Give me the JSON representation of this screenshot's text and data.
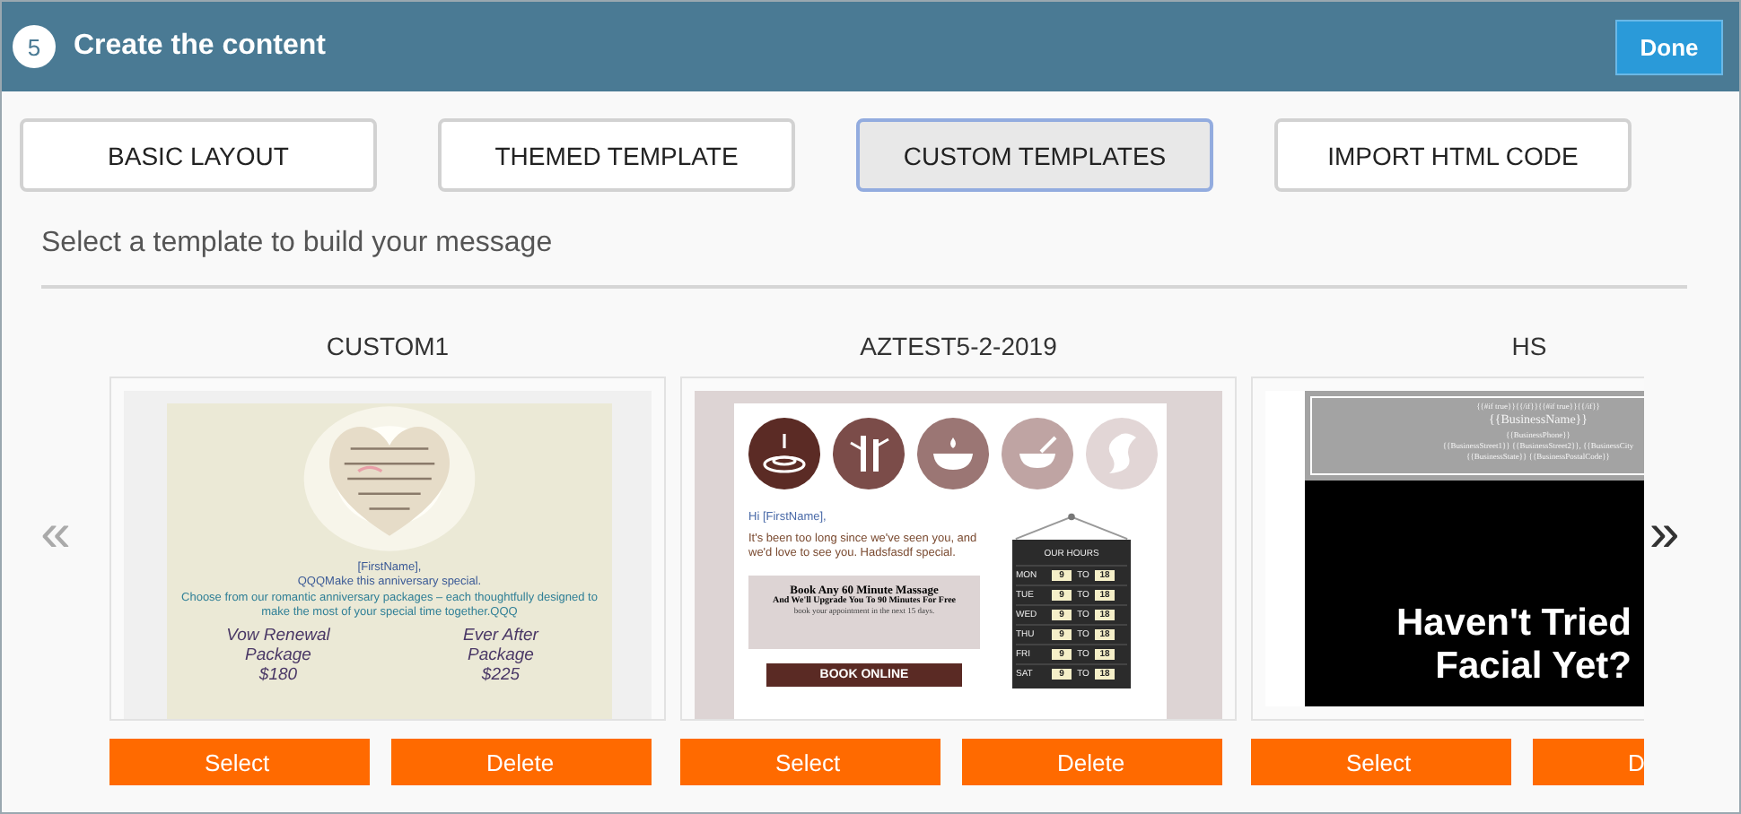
{
  "step": {
    "number": "5",
    "title": "Create the content",
    "done": "Done"
  },
  "tabs": [
    {
      "label": "BASIC LAYOUT",
      "selected": false
    },
    {
      "label": "THEMED TEMPLATE",
      "selected": false
    },
    {
      "label": "CUSTOM TEMPLATES",
      "selected": true
    },
    {
      "label": "IMPORT HTML CODE",
      "selected": false
    }
  ],
  "instruction": "Select a template to build your message",
  "carousel": {
    "prev": "«",
    "next": "»",
    "templates": [
      {
        "name": "CUSTOM1",
        "kind": "anniversary",
        "select": "Select",
        "delete": "Delete",
        "preview": {
          "greeting": "[FirstName],",
          "lines": [
            "QQQMake this anniversary special.",
            "Choose from our romantic anniversary packages – each thoughtfully designed to make the most of your special time together.QQQ"
          ],
          "packages": [
            {
              "name": "Vow Renewal Package",
              "price": "$180"
            },
            {
              "name": "Ever After Package",
              "price": "$225"
            }
          ]
        }
      },
      {
        "name": "AZTEST5-2-2019",
        "kind": "spa",
        "select": "Select",
        "delete": "Delete",
        "preview": {
          "icons": [
            {
              "kind": "drop",
              "color": "#5b2b25"
            },
            {
              "kind": "bamboo",
              "color": "#7b4c49"
            },
            {
              "kind": "bath",
              "color": "#9b7674"
            },
            {
              "kind": "mortar",
              "color": "#bfa4a3"
            },
            {
              "kind": "swirl",
              "color": "#e2d6d6"
            }
          ],
          "greeting": "Hi [FirstName],",
          "body": "It's been too long since we've seen you, and we'd love to see you. Hadsfasdf special.",
          "promo": {
            "title": "Book Any 60 Minute Massage",
            "subtitle": "And We'll Upgrade You To 90 Minutes For Free",
            "note": "book your appointment in the next 15 days."
          },
          "button": "BOOK ONLINE",
          "hours": {
            "title": "OUR HOURS",
            "rows": [
              {
                "day": "MON",
                "from": "9",
                "sep": "TO",
                "to": "18"
              },
              {
                "day": "TUE",
                "from": "9",
                "sep": "TO",
                "to": "18"
              },
              {
                "day": "WED",
                "from": "9",
                "sep": "TO",
                "to": "18"
              },
              {
                "day": "THU",
                "from": "9",
                "sep": "TO",
                "to": "18"
              },
              {
                "day": "FRI",
                "from": "9",
                "sep": "TO",
                "to": "18"
              },
              {
                "day": "SAT",
                "from": "9",
                "sep": "TO",
                "to": "18"
              }
            ]
          }
        }
      },
      {
        "name": "HS",
        "kind": "facial",
        "select": "Select",
        "delete": "D",
        "preview": {
          "header": [
            "{{#if true}}{{/if}}{{#if true}}{{/if}}",
            "{{BusinessName}}",
            "{{BusinessPhone}}",
            "{{BusinessStreet1}} {{BusinessStreet2}}, {{BusinessCity",
            "{{BusinessState}} {{BusinessPostalCode}}"
          ],
          "headline": [
            "Haven't Tried",
            "Facial Yet?"
          ]
        }
      }
    ]
  }
}
